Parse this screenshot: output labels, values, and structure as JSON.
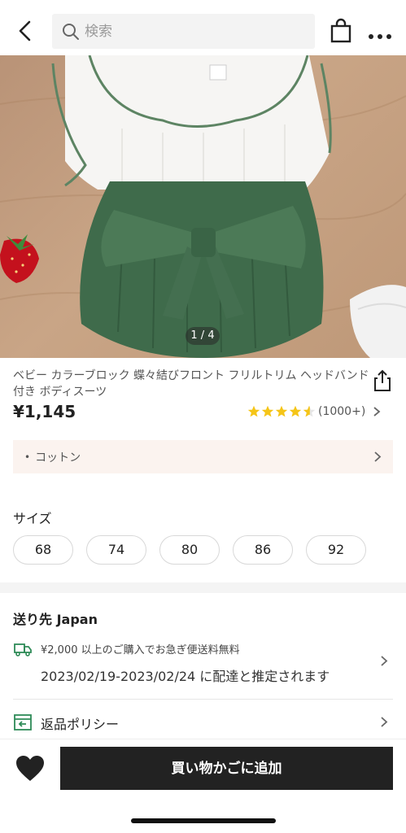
{
  "search": {
    "placeholder": "検索"
  },
  "gallery": {
    "pager_text": "1 / 4"
  },
  "product": {
    "title": "ベビー カラーブロック 蝶々結びフロント フリルトリム ヘッドバンド付き ボディスーツ",
    "price": "¥1,145",
    "rating": {
      "stars": 4.5,
      "count_text": "(1000+)"
    },
    "material": "コットン"
  },
  "size_section": {
    "title": "サイズ",
    "options": [
      "68",
      "74",
      "80",
      "86",
      "92"
    ]
  },
  "shipping": {
    "title": "送り先 Japan",
    "free_text": "¥2,000 以上のご購入でお急ぎ便送料無料",
    "estimate": "2023/02/19-2023/02/24 に配達と推定されます"
  },
  "returns": {
    "label": "返品ポリシー"
  },
  "actions": {
    "add_to_cart": "買い物かごに追加"
  },
  "colors": {
    "star": "#f5c518",
    "button": "#222222",
    "material_bg": "#fbf3ef",
    "shipping_icon": "#2e8b57"
  },
  "icons": [
    "back-icon",
    "search-icon",
    "bag-icon",
    "more-icon",
    "share-icon",
    "star-icon",
    "chevron-right-icon",
    "truck-icon",
    "return-icon",
    "heart-icon"
  ]
}
